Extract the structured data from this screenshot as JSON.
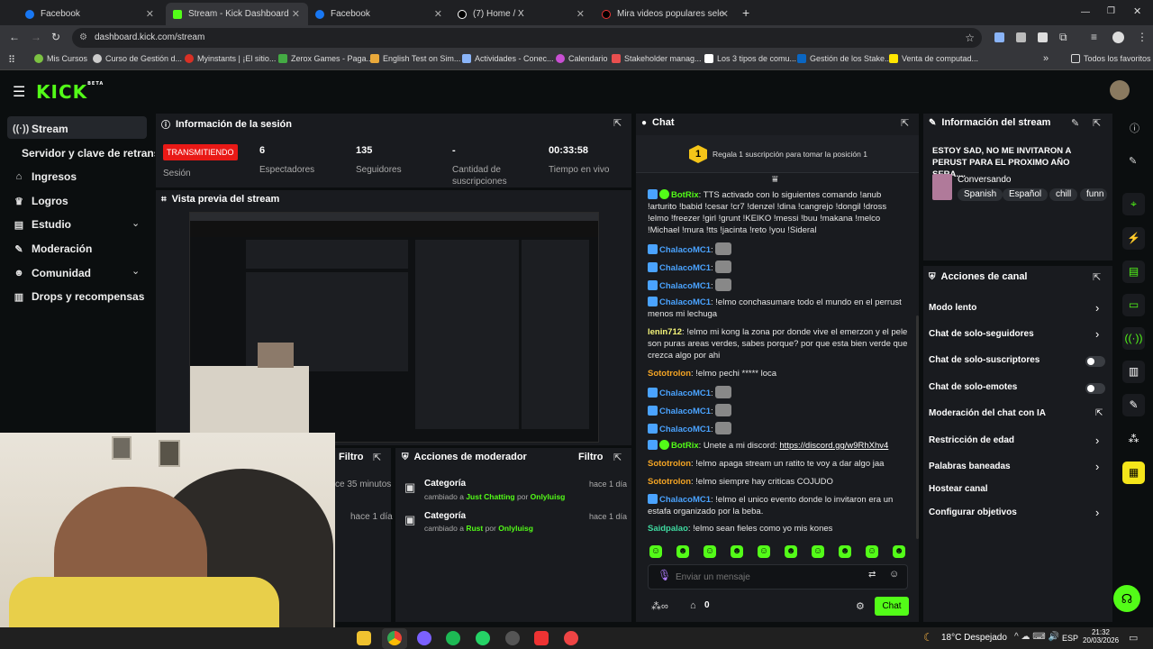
{
  "browser": {
    "tabs": [
      {
        "title": "Facebook",
        "icon": "facebook-icon",
        "color": "#1877f2"
      },
      {
        "title": "Stream - Kick Dashboard",
        "icon": "kick-icon",
        "color": "#53fc18"
      },
      {
        "title": "Facebook",
        "icon": "facebook-icon",
        "color": "#1877f2"
      },
      {
        "title": "(7) Home / X",
        "icon": "x-icon",
        "color": "#ffffff"
      },
      {
        "title": "Mira videos populares seleccio",
        "icon": "tiktok-icon",
        "color": "#ffffff"
      }
    ],
    "new_tab": "+",
    "url": "dashboard.kick.com/stream",
    "bookmarks": [
      {
        "label": "Mis Cursos",
        "color": "#7cc242"
      },
      {
        "label": "Curso de Gestión d...",
        "color": "#cccccc"
      },
      {
        "label": "Myinstants | ¡El sitio...",
        "color": "#d93025"
      },
      {
        "label": "Zerox Games - Paga...",
        "color": "#44aa44"
      },
      {
        "label": "English Test on Sim...",
        "color": "#e9a93b"
      },
      {
        "label": "Actividades - Conec...",
        "color": "#8ab4f8"
      },
      {
        "label": "Calendario",
        "color": "#c94fd3"
      },
      {
        "label": "Stakeholder manag...",
        "color": "#e94f4f"
      },
      {
        "label": "Los 3 tipos de comu...",
        "color": "#ffffff"
      },
      {
        "label": "Gestión de los Stake...",
        "color": "#0a66c2"
      },
      {
        "label": "Venta de computad...",
        "color": "#ffe600"
      }
    ],
    "all_favorites": "Todos los favoritos"
  },
  "kick": {
    "logo": "KICK",
    "logo_beta": "BETA"
  },
  "sidebar": {
    "items": [
      {
        "label": "Stream",
        "icon": "broadcast-icon"
      },
      {
        "label": "Servidor y clave de retransm",
        "icon": ""
      },
      {
        "label": "Ingresos",
        "icon": "bank-icon"
      },
      {
        "label": "Logros",
        "icon": "trophy-icon"
      },
      {
        "label": "Estudio",
        "icon": "studio-icon"
      },
      {
        "label": "Moderación",
        "icon": "wrench-icon"
      },
      {
        "label": "Comunidad",
        "icon": "community-icon"
      },
      {
        "label": "Drops y recompensas",
        "icon": "gift-icon"
      }
    ]
  },
  "session": {
    "title": "Información de la sesión",
    "live_badge": "TRANSMITIENDO",
    "session_label": "Sesión",
    "stats": [
      {
        "value": "6",
        "label": "Espectadores"
      },
      {
        "value": "135",
        "label": "Seguidores"
      },
      {
        "value": "-",
        "label": "Cantidad de suscripciones"
      },
      {
        "value": "00:33:58",
        "label": "Tiempo en vivo"
      }
    ]
  },
  "preview": {
    "title": "Vista previa del stream"
  },
  "activity": {
    "filter": "Filtro",
    "partial_time": "ce 35 minutos",
    "partial_time2": "hace 1 día"
  },
  "mod_actions": {
    "title": "Acciones de moderador",
    "filter": "Filtro",
    "items": [
      {
        "title": "Categoría",
        "prefix": "cambiado a ",
        "target": "Just Chatting",
        "by": " por ",
        "user": "Onlyluisg",
        "time": "hace 1 día"
      },
      {
        "title": "Categoría",
        "prefix": "cambiado a ",
        "target": "Rust",
        "by": " por ",
        "user": "Onlyluisg",
        "time": "hace 1 día"
      }
    ]
  },
  "chat": {
    "title": "Chat",
    "gift_number": "1",
    "gift_text": "Regala 1 suscripción para tomar la posición 1",
    "messages": [
      {
        "user": "BotRix",
        "color": "#53fc18",
        "text": "TTS activado con lo siguientes comando !anub !arturito !babid !cesar !cr7 !denzel !dina !cangrejo !dongil !dross !elmo !freezer !girl !grunt !KEIKO !messi !buu !makana !melco !Michael !mura !tts !jacinta !reto !you !Sideral"
      },
      {
        "user": "ChalacoMC1",
        "color": "#4aa3ff",
        "text": ""
      },
      {
        "user": "ChalacoMC1",
        "color": "#4aa3ff",
        "text": ""
      },
      {
        "user": "ChalacoMC1",
        "color": "#4aa3ff",
        "text": ""
      },
      {
        "user": "ChalacoMC1",
        "color": "#4aa3ff",
        "text": "!elmo conchasumare todo el mundo en el perrust menos mi lechuga"
      },
      {
        "user": "lenin712",
        "color": "#f5f57a",
        "text": "!elmo mi kong la zona por donde vive el emerzon y el pele son puras areas verdes, sabes porque? por que esta bien verde que crezca algo por ahi"
      },
      {
        "user": "Sototrolon",
        "color": "#f5a524",
        "text": "!elmo pechi ***** loca"
      },
      {
        "user": "ChalacoMC1",
        "color": "#4aa3ff",
        "text": ""
      },
      {
        "user": "ChalacoMC1",
        "color": "#4aa3ff",
        "text": ""
      },
      {
        "user": "ChalacoMC1",
        "color": "#4aa3ff",
        "text": ""
      },
      {
        "user": "BotRix",
        "color": "#53fc18",
        "text": "Unete a mi discord: ",
        "link": "https://discord.gg/w9RhXhv4"
      },
      {
        "user": "Sototrolon",
        "color": "#f5a524",
        "text": "!elmo apaga stream un ratito te voy a dar algo jaa"
      },
      {
        "user": "Sototrolon",
        "color": "#f5a524",
        "text": "!elmo siempre hay criticas COJUDO"
      },
      {
        "user": "ChalacoMC1",
        "color": "#4aa3ff",
        "text": "!elmo el unico evento donde lo invitaron era un estafa organizado por la beba."
      },
      {
        "user": "Saidpalao",
        "color": "#3fd9a0",
        "text": "!elmo sean fieles como yo mis kones"
      }
    ],
    "input_placeholder": "Enviar un mensaje",
    "points": "0",
    "send_label": "Chat"
  },
  "stream_info": {
    "title": "Información del stream",
    "stream_title": "ESTOY SAD, NO ME INVITARON A PERUST PARA EL PROXIMO AÑO SERA....",
    "category": "Conversando",
    "tags": [
      "Spanish",
      "Español",
      "chill",
      "funn"
    ]
  },
  "channel_actions": {
    "title": "Acciones de canal",
    "items": [
      {
        "label": "Modo lento",
        "control": "chevron"
      },
      {
        "label": "Chat de solo-seguidores",
        "control": "chevron"
      },
      {
        "label": "Chat de solo-suscriptores",
        "control": "toggle"
      },
      {
        "label": "Chat de solo-emotes",
        "control": "toggle"
      },
      {
        "label": "Moderación del chat con IA",
        "control": "external"
      },
      {
        "label": "Restricción de edad",
        "control": "chevron"
      },
      {
        "label": "Palabras baneadas",
        "control": "chevron"
      },
      {
        "label": "Hostear canal",
        "control": "none"
      },
      {
        "label": "Configurar objetivos",
        "control": "chevron"
      }
    ]
  },
  "taskbar": {
    "weather": "18°C  Despejado",
    "lang": "ESP",
    "time": "21:32",
    "date": "20/03/2026"
  }
}
